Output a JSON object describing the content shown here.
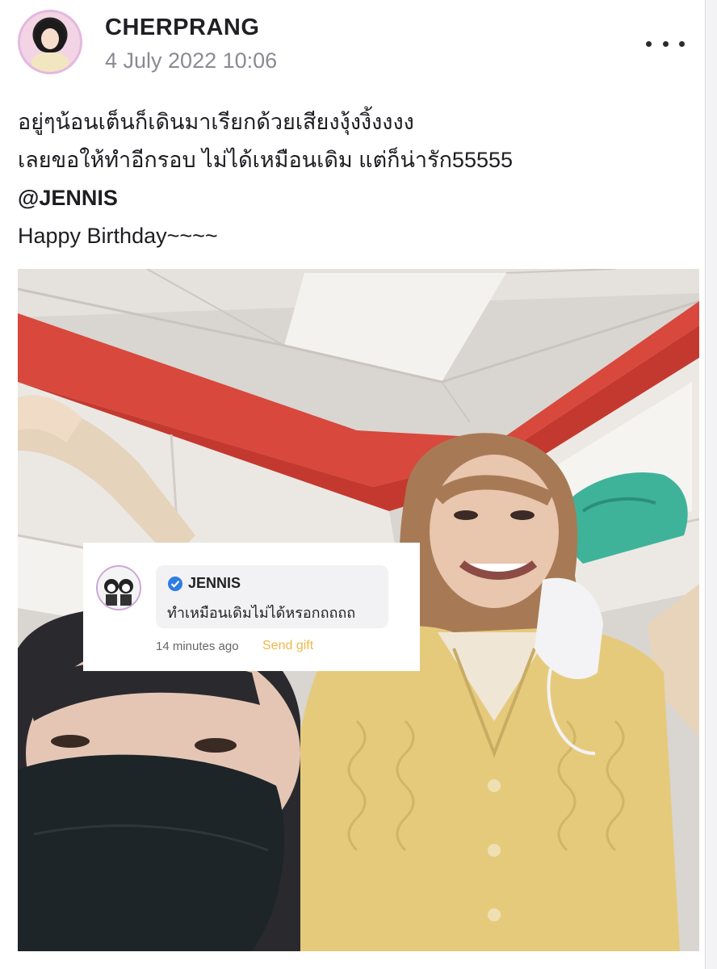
{
  "post": {
    "author": "CHERPRANG",
    "timestamp": "4 July 2022 10:06",
    "text_lines": [
      "อยู่ๆน้อนเต็นก็เดินมาเรียกด้วยเสียงงุ้งงิ้งงงง",
      "เลยขอให้ทำอีกรอบ ไม่ได้เหมือนเดิม แต่ก็น่ารัก55555"
    ],
    "mention": "@JENNIS",
    "greeting": "Happy Birthday~~~~",
    "more_icon": "more-horizontal-icon"
  },
  "comment": {
    "author": "JENNIS",
    "text": "ทำเหมือนเดิมไม่ได้หรอกถถถถ",
    "time_ago": "14 minutes ago",
    "send_gift_label": "Send gift",
    "verified_icon": "verified-badge-icon"
  },
  "colors": {
    "accent_gift": "#f0b74a",
    "verified_blue": "#2f7be5",
    "avatar_ring": "#e3b8e0",
    "photo_red_wall": "#d8483c",
    "sweater_yellow": "#e6ca7c"
  }
}
